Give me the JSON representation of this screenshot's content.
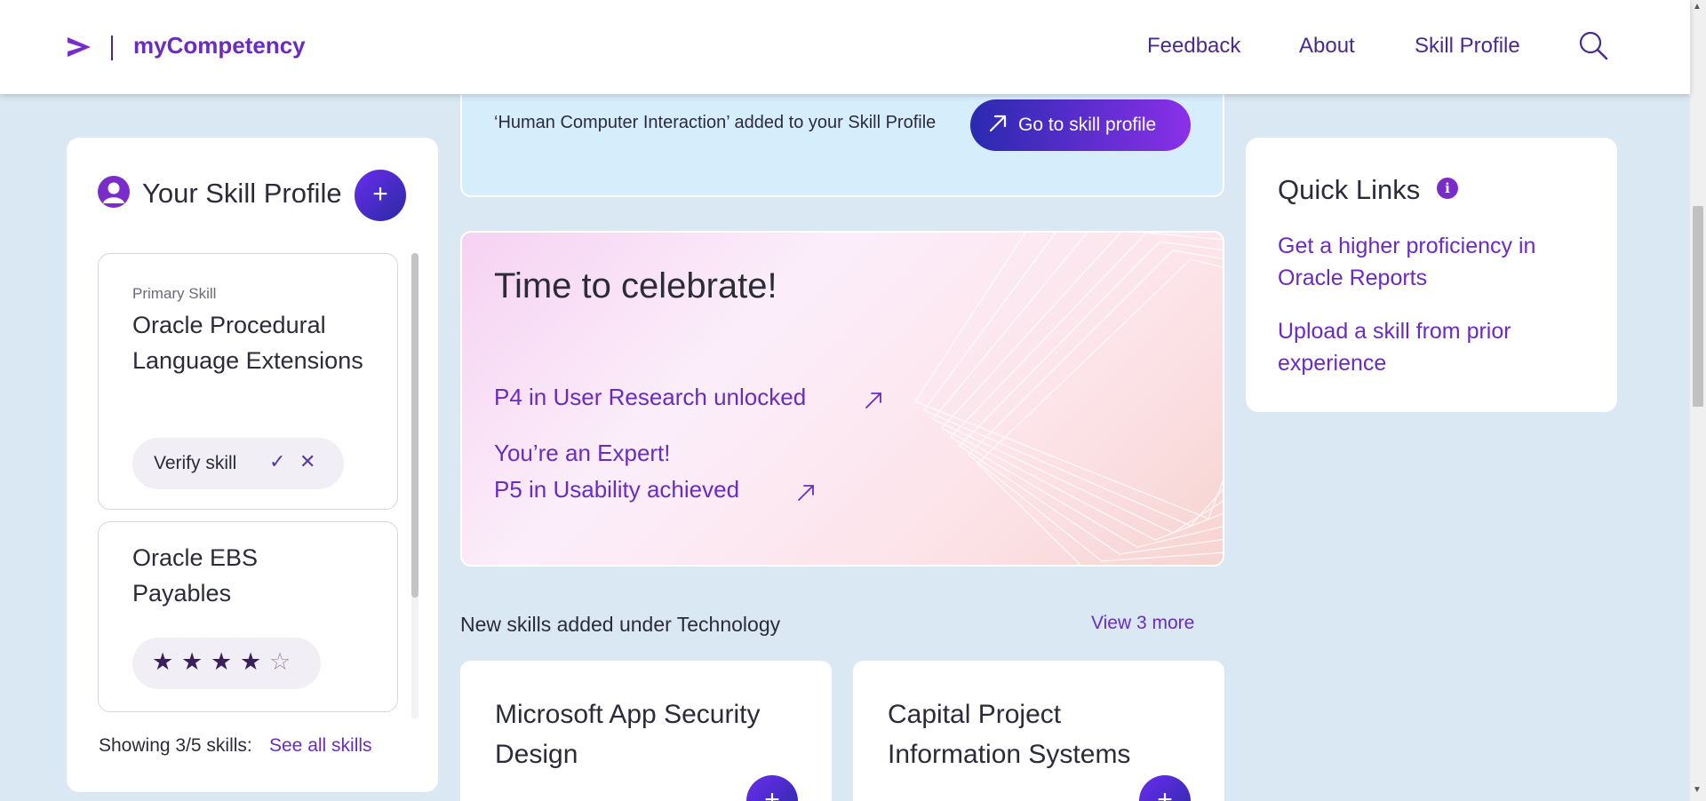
{
  "header": {
    "brand": "myCompetency",
    "nav": [
      "Feedback",
      "About",
      "Skill Profile"
    ]
  },
  "skill_profile": {
    "title": "Your Skill Profile",
    "skills": [
      {
        "tag": "Primary Skill",
        "name": "Oracle Procedural Language Extensions",
        "action_label": "Verify skill"
      },
      {
        "name": "Oracle EBS Payables",
        "rating": 4,
        "rating_max": 5
      }
    ],
    "showing": "Showing 3/5 skills:",
    "see_all": "See all skills"
  },
  "toast": {
    "message": "‘Human Computer Interaction’ added to your Skill Profile",
    "button_label": "Go to skill profile"
  },
  "celebrate": {
    "title": "Time to celebrate!",
    "link1": "P4 in User Research unlocked",
    "link2_line1": "You’re an Expert!",
    "link2_line2": "P5 in Usability achieved"
  },
  "new_skills": {
    "title": "New skills added under Technology",
    "view_more": "View 3 more",
    "cards": [
      "Microsoft App Security Design",
      "Capital Project Information Systems"
    ]
  },
  "quick_links": {
    "title": "Quick Links",
    "links": [
      "Get a higher proficiency in Oracle Reports",
      "Upload a skill from prior experience"
    ]
  },
  "colors": {
    "accent": "#6a2cc0",
    "background": "#d9e8f2",
    "toast_bg": "#d6eefb"
  }
}
